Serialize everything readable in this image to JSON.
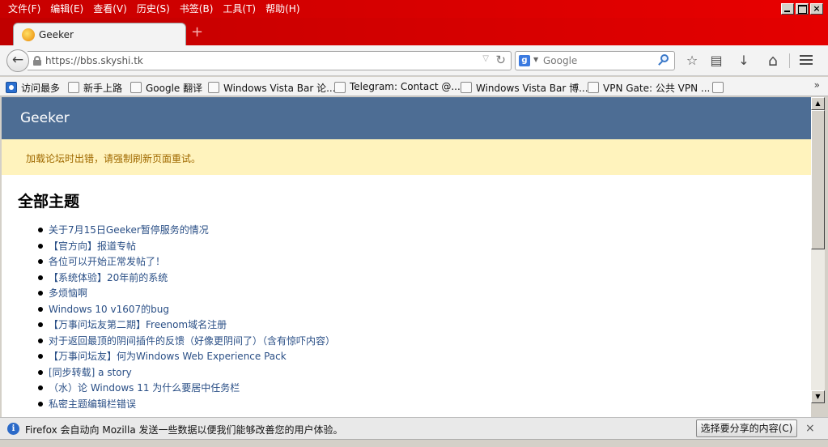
{
  "menu": [
    "文件(F)",
    "编辑(E)",
    "查看(V)",
    "历史(S)",
    "书签(B)",
    "工具(T)",
    "帮助(H)"
  ],
  "window_controls": {
    "close": "×"
  },
  "tab": {
    "title": "Geeker",
    "new_tab": "+"
  },
  "nav": {
    "back": "←",
    "url": "https://bbs.skyshi.tk",
    "search_placeholder": "Google",
    "search_engine_letter": "g",
    "star": "☆",
    "reading_list": "▤",
    "download": "↓",
    "home": "⌂"
  },
  "bookmarks": {
    "items": [
      "访问最多",
      "新手上路",
      "Google 翻译",
      "Windows Vista Bar 论...",
      "Telegram: Contact @...",
      "Windows Vista Bar 博...",
      "VPN Gate: 公共 VPN ..."
    ],
    "overflow": "»"
  },
  "forum": {
    "title": "Geeker",
    "alert": "加载论坛时出错，请强制刷新页面重试。",
    "heading": "全部主题",
    "topics": [
      "关于7月15日Geeker暂停服务的情况",
      "【官方向】报道专帖",
      "各位可以开始正常发帖了！",
      "【系统体验】20年前的系统",
      "多烦恼啊",
      "Windows 10 v1607的bug",
      "【万事问坛友第二期】Freenom域名注册",
      "对于返回最顶的阴间插件的反馈（好像更阴间了）（含有惊吓内容）",
      "【万事问坛友】何为Windows Web Experience Pack",
      "[同步转载] a story",
      "（水）论 Windows 11 为什么要居中任务栏",
      "私密主题编辑栏错误"
    ]
  },
  "notification": {
    "text": "Firefox 会自动向 Mozilla 发送一些数据以便我们能够改善您的用户体验。",
    "button": "选择要分享的内容(C)",
    "close": "×",
    "info": "i"
  },
  "scrollbar": {
    "up": "▲",
    "down": "▼"
  }
}
